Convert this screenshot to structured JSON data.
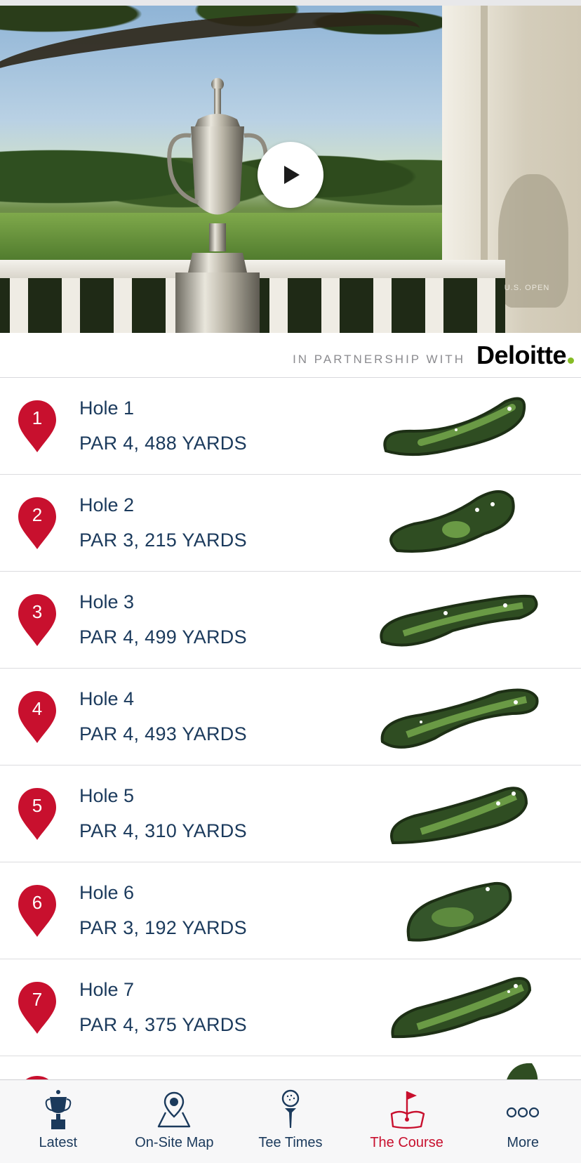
{
  "hero": {
    "watermark": "U.S. OPEN",
    "play_icon": "play-icon"
  },
  "partner": {
    "label": "IN PARTNERSHIP WITH",
    "brand": "Deloitte",
    "brand_dot_color": "#86bc25"
  },
  "holes": [
    {
      "number": "1",
      "title": "Hole 1",
      "detail": "PAR 4, 488 YARDS"
    },
    {
      "number": "2",
      "title": "Hole 2",
      "detail": "PAR 3, 215 YARDS"
    },
    {
      "number": "3",
      "title": "Hole 3",
      "detail": "PAR 4, 499 YARDS"
    },
    {
      "number": "4",
      "title": "Hole 4",
      "detail": "PAR 4, 493 YARDS"
    },
    {
      "number": "5",
      "title": "Hole 5",
      "detail": "PAR 4, 310 YARDS"
    },
    {
      "number": "6",
      "title": "Hole 6",
      "detail": "PAR 3, 192 YARDS"
    },
    {
      "number": "7",
      "title": "Hole 7",
      "detail": "PAR 4, 375 YARDS"
    }
  ],
  "tabs": [
    {
      "label": "Latest",
      "icon": "trophy-icon",
      "active": false
    },
    {
      "label": "On-Site Map",
      "icon": "map-pin-icon",
      "active": false
    },
    {
      "label": "Tee Times",
      "icon": "golf-tee-icon",
      "active": false
    },
    {
      "label": "The Course",
      "icon": "flag-green-icon",
      "active": true
    },
    {
      "label": "More",
      "icon": "more-dots-icon",
      "active": false
    }
  ],
  "colors": {
    "accent_red": "#c8102e",
    "navy_text": "#1b3a5c",
    "divider": "#dcdcdf"
  }
}
